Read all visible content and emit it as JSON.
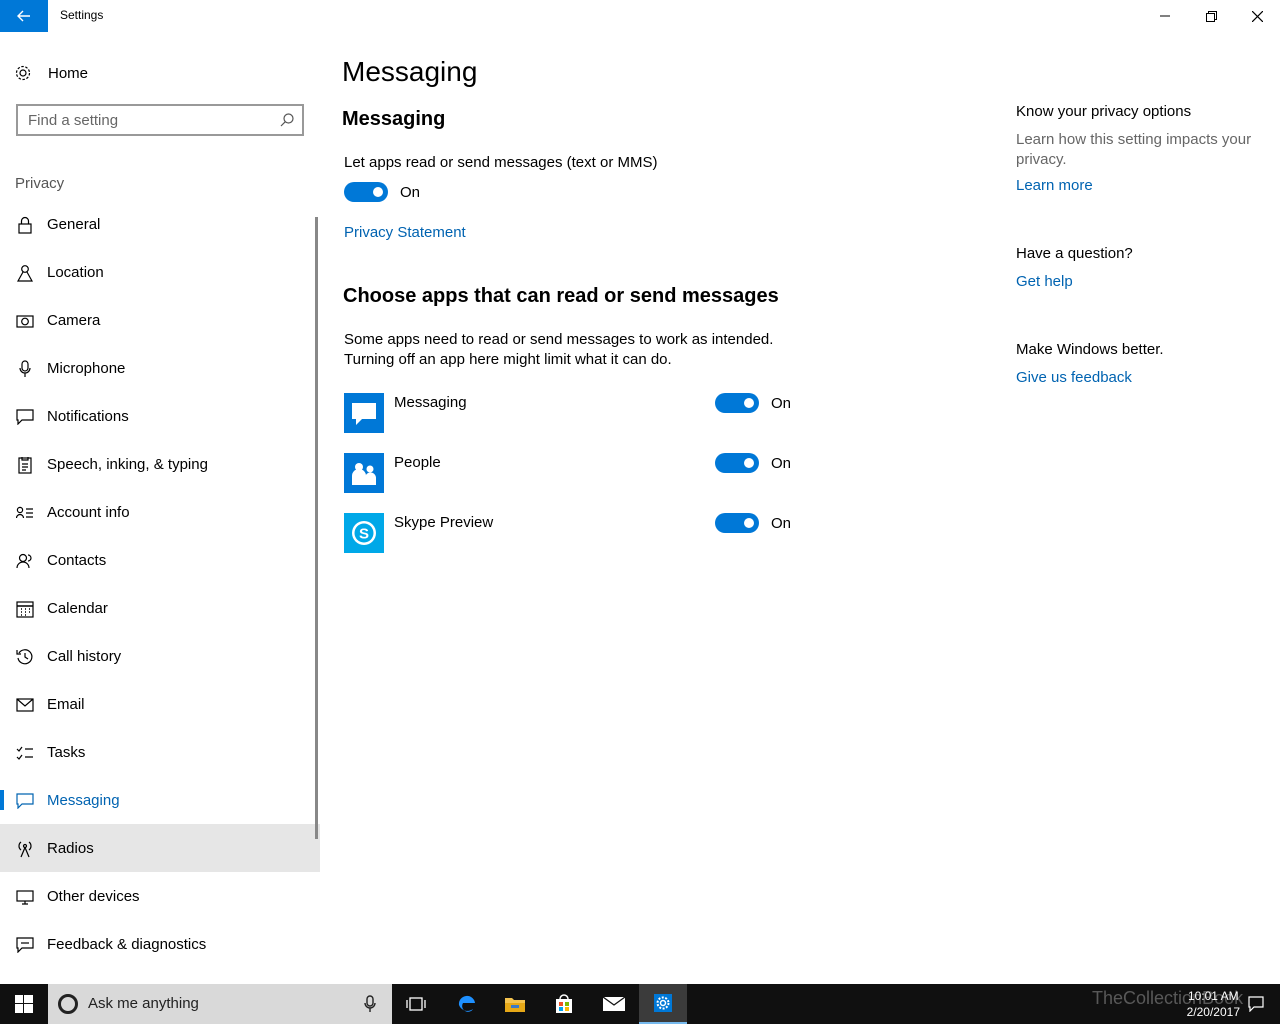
{
  "window": {
    "title": "Settings"
  },
  "sidebar": {
    "home_label": "Home",
    "search_placeholder": "Find a setting",
    "section_label": "Privacy",
    "items": [
      {
        "label": "General",
        "icon": "lock-icon"
      },
      {
        "label": "Location",
        "icon": "location-icon"
      },
      {
        "label": "Camera",
        "icon": "camera-icon"
      },
      {
        "label": "Microphone",
        "icon": "microphone-icon"
      },
      {
        "label": "Notifications",
        "icon": "notifications-icon"
      },
      {
        "label": "Speech, inking, & typing",
        "icon": "speech-icon"
      },
      {
        "label": "Account info",
        "icon": "account-info-icon"
      },
      {
        "label": "Contacts",
        "icon": "contacts-icon"
      },
      {
        "label": "Calendar",
        "icon": "calendar-icon"
      },
      {
        "label": "Call history",
        "icon": "call-history-icon"
      },
      {
        "label": "Email",
        "icon": "email-icon"
      },
      {
        "label": "Tasks",
        "icon": "tasks-icon"
      },
      {
        "label": "Messaging",
        "icon": "messaging-icon",
        "active": true
      },
      {
        "label": "Radios",
        "icon": "radios-icon",
        "hover": true
      },
      {
        "label": "Other devices",
        "icon": "other-devices-icon"
      },
      {
        "label": "Feedback & diagnostics",
        "icon": "feedback-icon"
      }
    ]
  },
  "main": {
    "page_title": "Messaging",
    "section_title": "Messaging",
    "master_toggle": {
      "description": "Let apps read or send messages (text or MMS)",
      "state_label": "On",
      "on": true
    },
    "privacy_statement_link": "Privacy Statement",
    "apps_heading": "Choose apps that can read or send messages",
    "apps_description_line1": "Some apps need to read or send messages to work as intended.",
    "apps_description_line2": "Turning off an app here might limit what it can do.",
    "apps": [
      {
        "name": "Messaging",
        "state_label": "On",
        "on": true,
        "icon": "messaging-app-icon"
      },
      {
        "name": "People",
        "state_label": "On",
        "on": true,
        "icon": "people-app-icon"
      },
      {
        "name": "Skype Preview",
        "state_label": "On",
        "on": true,
        "icon": "skype-app-icon"
      }
    ]
  },
  "right_panel": {
    "privacy_heading": "Know your privacy options",
    "privacy_text": "Learn how this setting impacts your privacy.",
    "learn_more": "Learn more",
    "question_heading": "Have a question?",
    "get_help": "Get help",
    "feedback_heading": "Make Windows better.",
    "feedback_link": "Give us feedback"
  },
  "taskbar": {
    "search_text": "Ask me anything",
    "time": "10:01 AM",
    "date": "2/20/2017",
    "watermark": "TheCollectionBook"
  },
  "colors": {
    "accent": "#0078d7",
    "link": "#0063b1",
    "hover_bg": "#e6e6e6",
    "taskbar": "#101010"
  }
}
